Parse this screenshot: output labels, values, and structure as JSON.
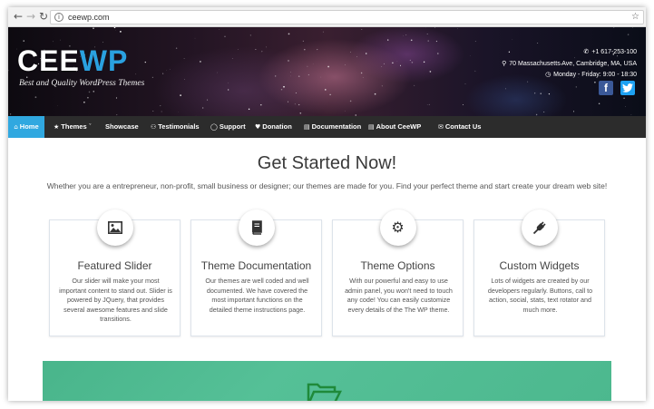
{
  "browser": {
    "url": "ceewp.com",
    "back_icon": "arrow-left-icon",
    "forward_icon": "arrow-right-icon",
    "reload_icon": "reload-icon",
    "star_icon": "star-icon"
  },
  "header": {
    "logo_part1": "CEE",
    "logo_part2": "WP",
    "tagline": "Best and Quality WordPress Themes",
    "phone": "+1 617-253-100",
    "address": "70 Massachusetts Ave, Cambridge, MA, USA",
    "hours": "Monday - Friday: 9:00 - 18:30",
    "social": [
      {
        "name": "facebook-icon",
        "glyph": "f"
      },
      {
        "name": "twitter-icon",
        "glyph": "t"
      }
    ],
    "logo_blue": "#2aa1e0"
  },
  "nav": {
    "items": [
      {
        "label": "Home",
        "icon": "home-icon",
        "active": true
      },
      {
        "label": "Themes",
        "icon": "star-icon"
      },
      {
        "label": "Showcase"
      },
      {
        "label": "Testimonials",
        "icon": "users-icon"
      },
      {
        "label": "Support",
        "icon": "lifebuoy-icon"
      },
      {
        "label": "Donation",
        "icon": "heart-icon"
      },
      {
        "label": "Documentation",
        "icon": "file-icon"
      },
      {
        "label": "About CeeWP",
        "icon": "file-icon"
      },
      {
        "label": "Contact Us",
        "icon": "envelope-icon"
      }
    ],
    "active_color": "#30a8e0"
  },
  "hero": {
    "title": "Get Started Now!",
    "subtitle": "Whether you are a entrepreneur, non-profit, small business or designer; our themes are made for you. Find your perfect theme and start create your dream web site!"
  },
  "features": [
    {
      "icon": "image-icon",
      "title": "Featured Slider",
      "text": "Our slider will make your most important content to stand out. Slider is powered by JQuery, that provides several awesome features and slide transitions."
    },
    {
      "icon": "book-icon",
      "title": "Theme Documentation",
      "text": "Our themes are well coded and well documented. We have covered the most important functions on the detailed theme instructions page."
    },
    {
      "icon": "gear-icon",
      "title": "Theme Options",
      "text": "With our powerful and easy to use admin panel, you won't need to touch any code! You can easily customize every details of the The WP theme."
    },
    {
      "icon": "plug-icon",
      "title": "Custom Widgets",
      "text": "Lots of widgets are created by our developers regularly. Buttons, call to action, social, stats, text rotator and much more."
    }
  ],
  "banner": {
    "icon": "folder-open-icon",
    "color": "#4cb88e"
  }
}
